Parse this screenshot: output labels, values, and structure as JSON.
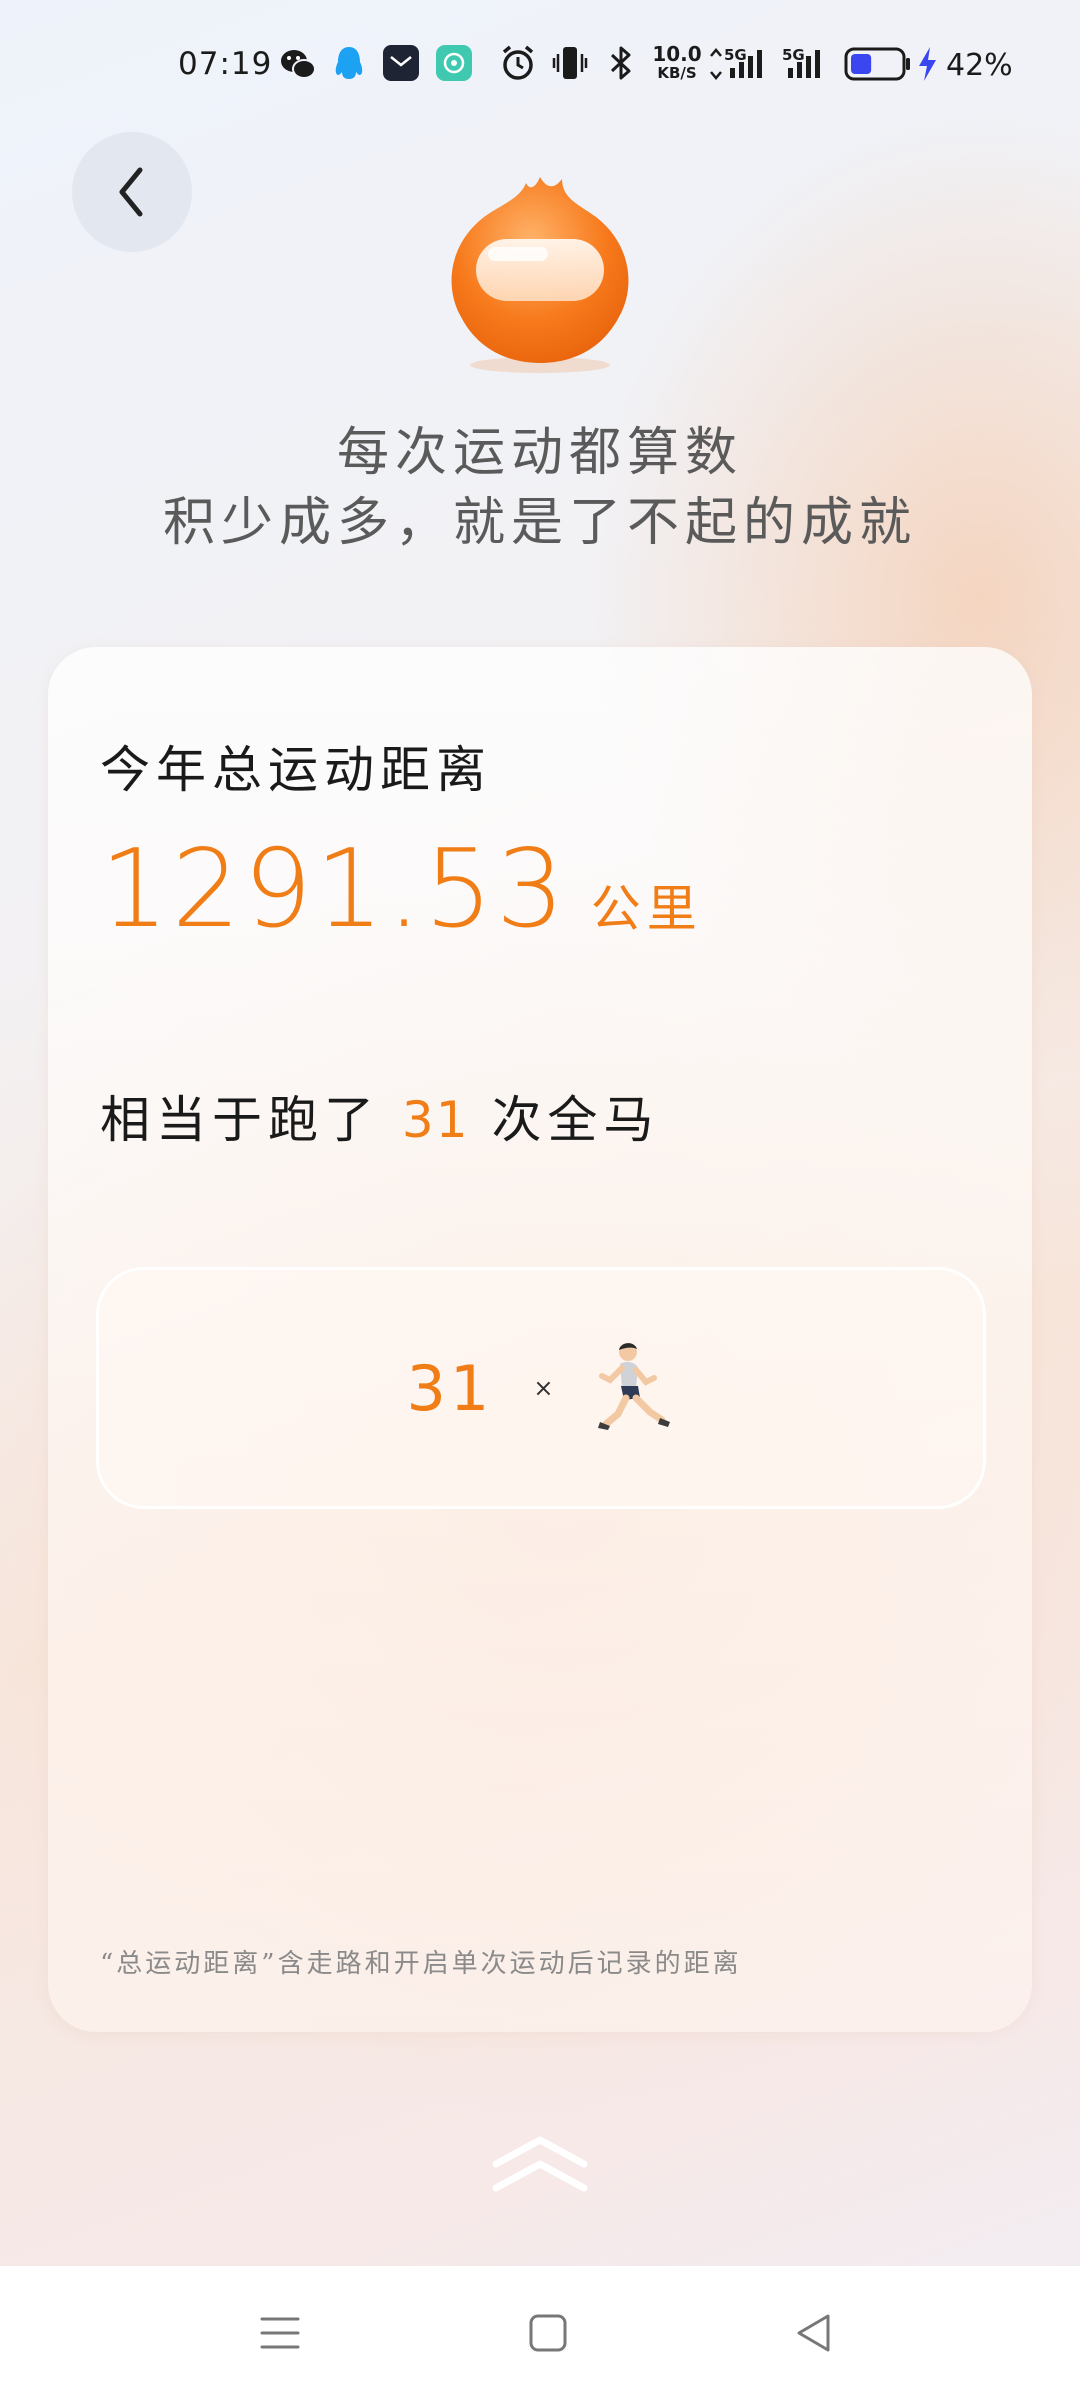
{
  "status_bar": {
    "time": "07:19",
    "net_speed": "10.0",
    "net_speed_unit": "KB/S",
    "battery_percent": "42%",
    "icons": [
      "wechat-icon",
      "qq-icon",
      "mail-app-icon",
      "chat-app-icon",
      "alarm-icon",
      "vibrate-icon",
      "bluetooth-icon",
      "signal-5g-icon",
      "signal-5g-icon",
      "battery-icon",
      "charging-icon"
    ],
    "battery_level": 0.42,
    "battery_color": "#3a46f0"
  },
  "header": {
    "back_icon": "chevron-left-icon",
    "slogan_line1": "每次运动都算数",
    "slogan_line2": "积少成多，就是了不起的成就"
  },
  "card": {
    "label": "今年总运动距离",
    "distance_value": "1291.53",
    "distance_unit": "公里",
    "equiv_prefix": "相当于跑了",
    "equiv_count": "31",
    "equiv_suffix": "次全马",
    "marathon_count": "31",
    "times_sign": "×",
    "runner_icon": "runner-icon",
    "footnote": "“总运动距离”含走路和开启单次运动后记录的距离"
  },
  "swipe_hint_icon": "double-chevron-up-icon",
  "nav": {
    "menu_icon": "menu-icon",
    "home_icon": "home-square-icon",
    "back_icon": "back-triangle-icon"
  },
  "colors": {
    "accent": "#f07d16",
    "text": "#1a1a1a",
    "muted": "#8a8a8a"
  }
}
